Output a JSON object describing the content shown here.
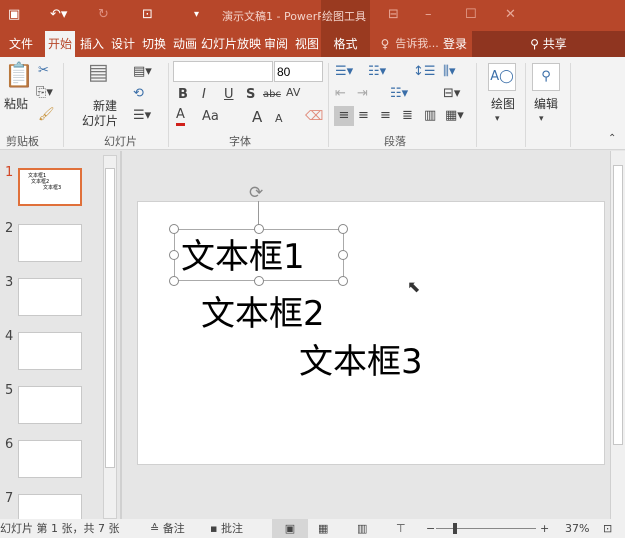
{
  "window": {
    "title": "演示文稿1 - PowerPoint",
    "context_tab_group": "绘图工具",
    "colors": {
      "accent": "#b7472a"
    }
  },
  "qat": {
    "save": "save-icon",
    "undo": "undo-icon",
    "redo": "redo-icon",
    "present": "present-icon",
    "more": "▾"
  },
  "tabs": [
    {
      "label": "文件"
    },
    {
      "label": "开始",
      "active": true
    },
    {
      "label": "插入"
    },
    {
      "label": "设计"
    },
    {
      "label": "切换"
    },
    {
      "label": "动画"
    },
    {
      "label": "幻灯片放映"
    },
    {
      "label": "审阅"
    },
    {
      "label": "视图"
    },
    {
      "label": "格式"
    }
  ],
  "tell_me": "告诉我...",
  "login": "登录",
  "share": "共享",
  "ribbon": {
    "clipboard": {
      "label": "剪贴板",
      "paste": "粘贴"
    },
    "slides": {
      "label": "幻灯片",
      "new_slide_1": "新建",
      "new_slide_2": "幻灯片"
    },
    "font": {
      "label": "字体",
      "font_name": "",
      "font_size": "80",
      "bold": "B",
      "italic": "I",
      "underline": "U",
      "shadow": "S",
      "strike": "abc",
      "spacing": "AV",
      "color": "A",
      "case": "Aa",
      "grow": "A",
      "shrink": "A"
    },
    "paragraph": {
      "label": "段落"
    },
    "drawing": {
      "label": "绘图"
    },
    "editing": {
      "label": "编辑"
    }
  },
  "slides": [
    {
      "number": "1",
      "selected": true,
      "thumb_lines": [
        "文本框1",
        "文本框2",
        "文本框3"
      ]
    },
    {
      "number": "2"
    },
    {
      "number": "3"
    },
    {
      "number": "4"
    },
    {
      "number": "5"
    },
    {
      "number": "6"
    },
    {
      "number": "7"
    }
  ],
  "canvas": {
    "textboxes": [
      "文本框1",
      "文本框2",
      "文本框3"
    ]
  },
  "status": {
    "slide_info": "幻灯片 第 1 张，共 7 张",
    "notes": "备注",
    "comments": "批注",
    "zoom": "37%",
    "zoom_level_percent": 37
  }
}
